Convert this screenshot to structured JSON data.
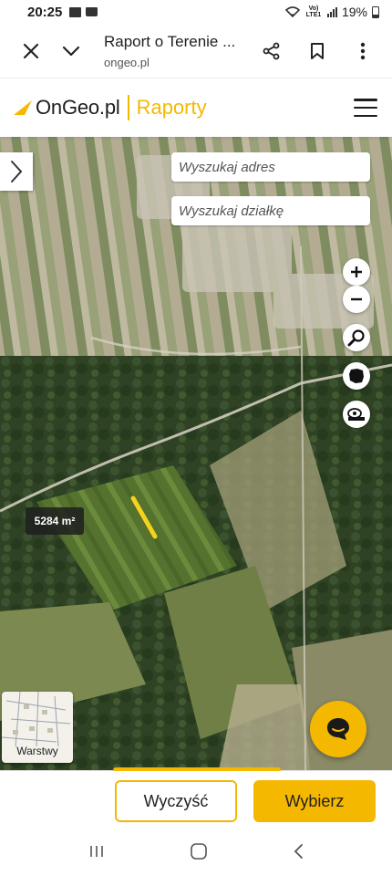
{
  "status_bar": {
    "time": "20:25",
    "network_label": "Vo) LTE1",
    "battery": "19%"
  },
  "browser": {
    "page_title": "Raport o Terenie ...",
    "url": "ongeo.pl",
    "icons": [
      "close-icon",
      "chevron-down-icon",
      "share-icon",
      "bookmark-icon",
      "more-vert-icon"
    ]
  },
  "site": {
    "logo_text": "OnGeo.pl",
    "section": "Raporty",
    "menu_icon": "hamburger-icon",
    "accent_color": "#f5b800"
  },
  "map": {
    "search_address_placeholder": "Wyszukaj adres",
    "search_plot_placeholder": "Wyszukaj działkę",
    "plot_area": "5284 m²",
    "layers_label": "Warstwy",
    "controls": [
      "zoom-in-icon",
      "zoom-out-icon",
      "search-icon",
      "poland-map-icon",
      "measure-icon"
    ]
  },
  "actions": {
    "clear_label": "Wyczyść",
    "select_label": "Wybierz"
  },
  "android_nav": [
    "recents-icon",
    "home-icon",
    "back-icon"
  ]
}
